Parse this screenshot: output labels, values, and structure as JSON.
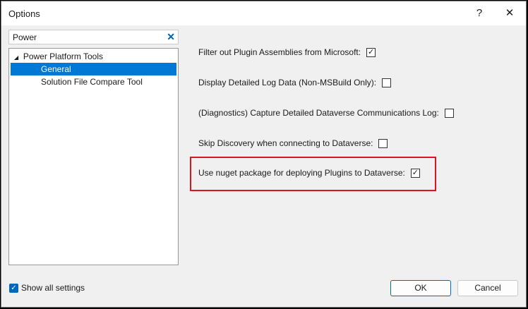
{
  "window": {
    "title": "Options",
    "help": "?",
    "close": "✕"
  },
  "search": {
    "value": "Power",
    "clear": "✕"
  },
  "tree": {
    "root": "Power Platform Tools",
    "children": [
      "General",
      "Solution File Compare Tool"
    ],
    "selected": "General"
  },
  "options": [
    {
      "label": "Filter out Plugin Assemblies from Microsoft:",
      "checked": true
    },
    {
      "label": "Display Detailed Log Data (Non-MSBuild Only):",
      "checked": false
    },
    {
      "label": "(Diagnostics) Capture Detailed Dataverse Communications Log:",
      "checked": false
    },
    {
      "label": "Skip Discovery when connecting to Dataverse:",
      "checked": false
    },
    {
      "label": "Use nuget package for deploying Plugins to Dataverse:",
      "checked": true
    }
  ],
  "footer": {
    "show_all": "Show all settings",
    "show_all_checked": true,
    "ok": "OK",
    "cancel": "Cancel"
  }
}
